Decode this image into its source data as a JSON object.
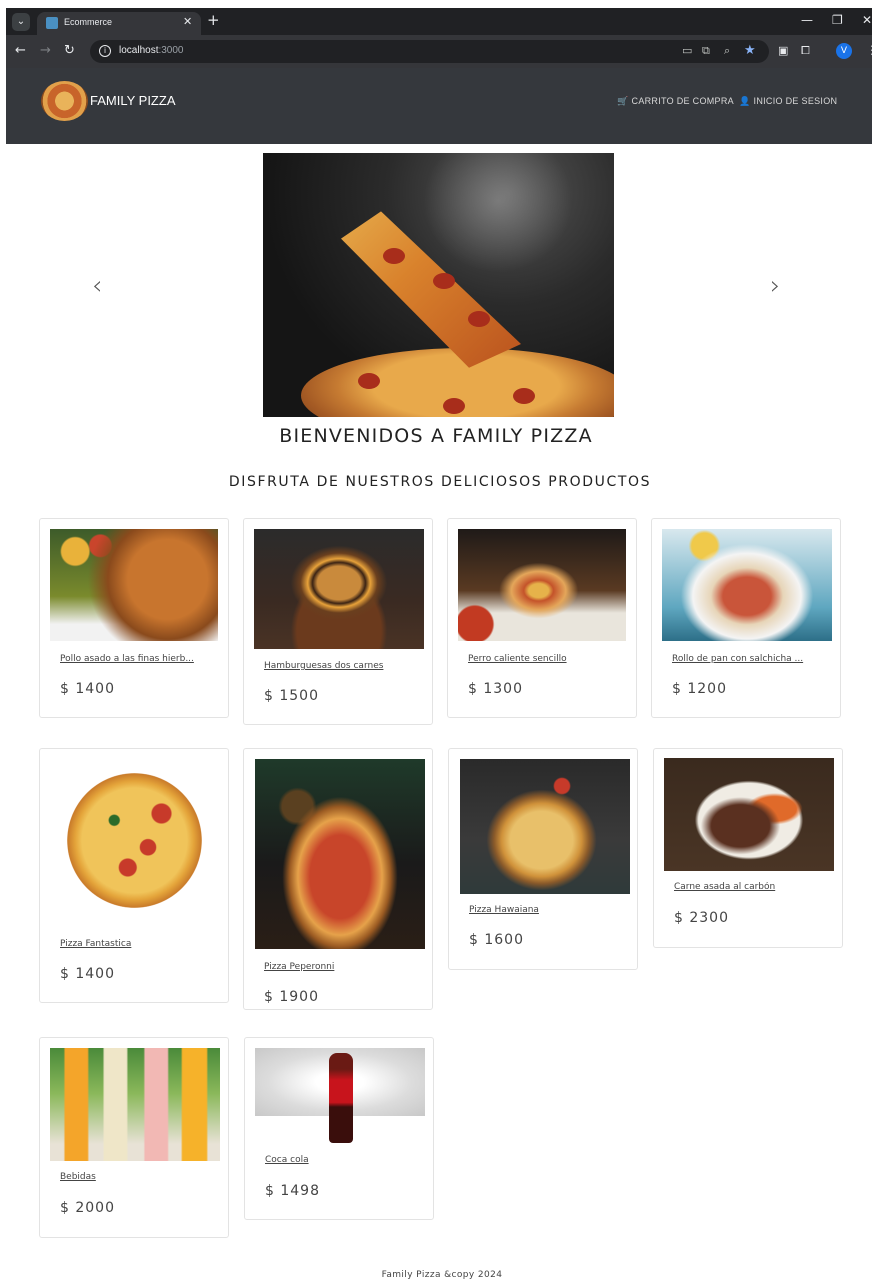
{
  "browser": {
    "tab_title": "Ecommerce",
    "url_host": "localhost",
    "url_port": ":3000",
    "avatar_letter": "V"
  },
  "site": {
    "brand": "FAMILY PIZZA",
    "nav": [
      {
        "label": "CARRITO DE COMPRA",
        "icon": "cart-icon"
      },
      {
        "label": "INICIO DE SESION",
        "icon": "user-icon"
      }
    ]
  },
  "hero": {
    "headline": "BIENVENIDOS A FAMILY PIZZA",
    "subheadline": "DISFRUTA DE NUESTROS DELICIOSOS PRODUCTOS"
  },
  "products": [
    {
      "name": "Pollo asado a las finas hierb...",
      "price": "$ 1400"
    },
    {
      "name": "Hamburguesas dos carnes",
      "price": "$ 1500"
    },
    {
      "name": "Perro caliente sencillo",
      "price": "$ 1300"
    },
    {
      "name": "Rollo de pan con salchicha ...",
      "price": "$ 1200"
    },
    {
      "name": "Pizza Fantastica",
      "price": "$ 1400"
    },
    {
      "name": "Pizza Peperonni",
      "price": "$ 1900"
    },
    {
      "name": "Pizza Hawaiana",
      "price": "$ 1600"
    },
    {
      "name": "Carne asada al carbón",
      "price": "$ 2300"
    },
    {
      "name": "Bebidas",
      "price": "$ 2000"
    },
    {
      "name": "Coca cola",
      "price": "$ 1498"
    }
  ],
  "footer": {
    "text": "Family Pizza &copy 2024"
  }
}
